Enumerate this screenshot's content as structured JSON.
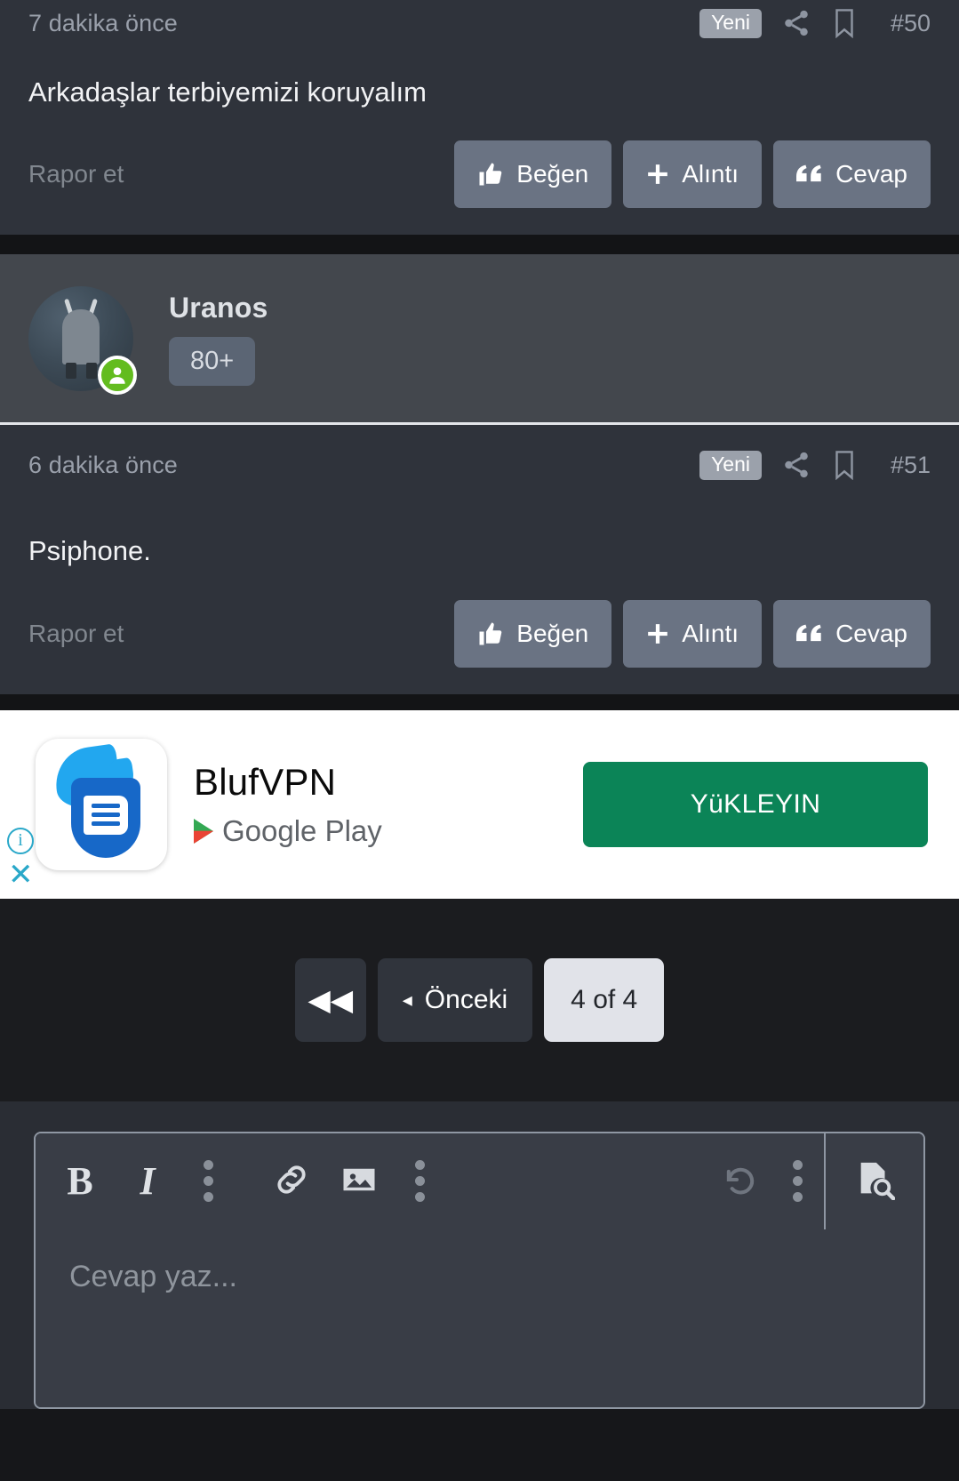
{
  "posts": [
    {
      "time": "7 dakika önce",
      "badge": "Yeni",
      "number": "#50",
      "content": "Arkadaşlar terbiyemizi koruyalım",
      "report_label": "Rapor et",
      "actions": [
        {
          "label": "Beğen",
          "icon": "thumbs-up-icon"
        },
        {
          "label": "Alıntı",
          "icon": "plus-icon"
        },
        {
          "label": "Cevap",
          "icon": "quote-icon"
        }
      ]
    },
    {
      "time": "6 dakika önce",
      "badge": "Yeni",
      "number": "#51",
      "content": "Psiphone.",
      "report_label": "Rapor et",
      "actions": [
        {
          "label": "Beğen",
          "icon": "thumbs-up-icon"
        },
        {
          "label": "Alıntı",
          "icon": "plus-icon"
        },
        {
          "label": "Cevap",
          "icon": "quote-icon"
        }
      ]
    }
  ],
  "user": {
    "name": "Uranos",
    "badge": "80+",
    "status": "online"
  },
  "ad": {
    "title": "BlufVPN",
    "store": "Google Play",
    "cta": "YüKLEYIN",
    "info_glyph": "i",
    "close_glyph": "✕"
  },
  "pagination": {
    "first_label": "◀◀",
    "prev_caret": "◂",
    "prev_label": "Önceki",
    "count_label": "4 of 4"
  },
  "editor": {
    "placeholder": "Cevap yaz...",
    "tools": [
      {
        "name": "bold",
        "glyph": "B"
      },
      {
        "name": "italic",
        "glyph": "I"
      },
      {
        "name": "more-text-options",
        "glyph": "⋮"
      },
      {
        "name": "link",
        "glyph": "link"
      },
      {
        "name": "image",
        "glyph": "image"
      },
      {
        "name": "more-insert-options",
        "glyph": "⋮"
      },
      {
        "name": "undo",
        "glyph": "undo"
      },
      {
        "name": "more-history-options",
        "glyph": "⋮"
      },
      {
        "name": "preview",
        "glyph": "preview"
      }
    ]
  },
  "colors": {
    "post_bg": "#2f333b",
    "user_bg": "#43474d",
    "action_btn": "#6a7383",
    "ad_cta": "#0b8457",
    "online": "#63bc1f",
    "page_bg": "#16171a"
  }
}
